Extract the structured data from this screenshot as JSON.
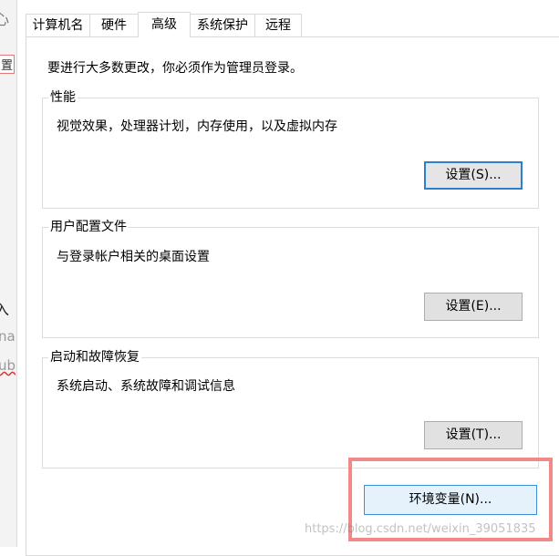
{
  "left_strip": {
    "text1": "心",
    "text2": "置",
    "text3": "入",
    "text4": "na",
    "text5": "ub"
  },
  "tabs": [
    {
      "label": "计算机名"
    },
    {
      "label": "硬件"
    },
    {
      "label": "高级"
    },
    {
      "label": "系统保护"
    },
    {
      "label": "远程"
    }
  ],
  "intro": "要进行大多数更改，你必须作为管理员登录。",
  "performance": {
    "title": "性能",
    "desc": "视觉效果，处理器计划，内存使用，以及虚拟内存",
    "button": "设置(S)..."
  },
  "user_profiles": {
    "title": "用户配置文件",
    "desc": "与登录帐户相关的桌面设置",
    "button": "设置(E)..."
  },
  "startup_recovery": {
    "title": "启动和故障恢复",
    "desc": "系统启动、系统故障和调试信息",
    "button": "设置(T)..."
  },
  "env_button": "环境变量(N)...",
  "watermark": "https://blog.csdn.net/weixin_39051835",
  "colors": {
    "focus_border": "#2d7fd2",
    "env_bg": "#e5f1fb",
    "highlight": "#f08a8a"
  }
}
